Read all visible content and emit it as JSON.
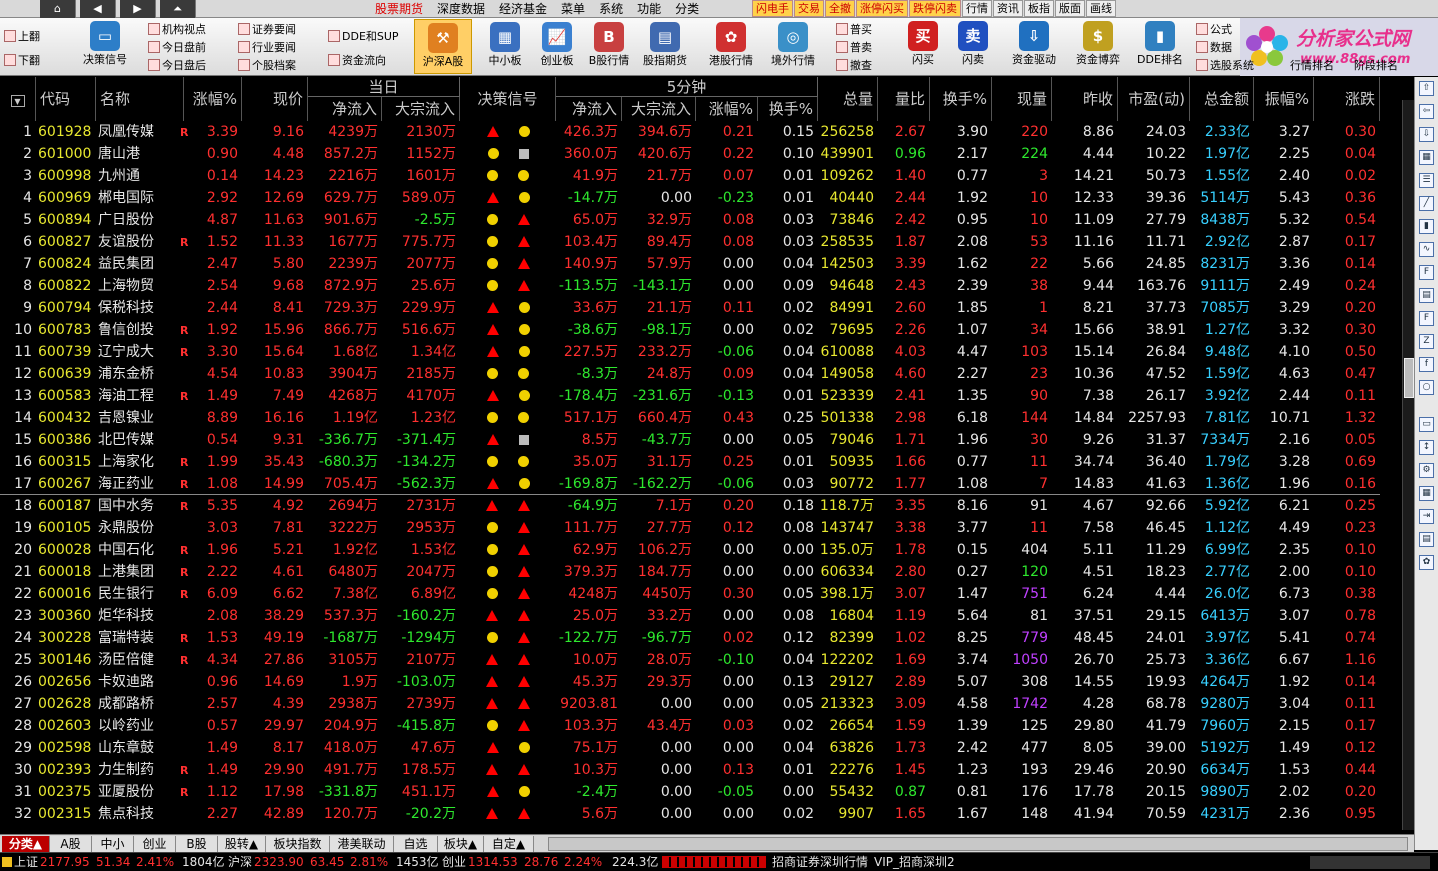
{
  "topbar": {
    "menus": [
      "股票期货",
      "深度数据",
      "经济基金",
      "菜单",
      "系统",
      "功能",
      "分类"
    ],
    "active_menu": "股票期货",
    "quick": [
      "闪电手",
      "交易",
      "全撤",
      "涨停闪买",
      "跌停闪卖",
      "行情",
      "资讯",
      "板指",
      "版面",
      "画线"
    ]
  },
  "toolbar": {
    "page_up": "上翻",
    "page_down": "下翻",
    "decision": "决策信号",
    "group1": [
      "机构视点",
      "今日盘前",
      "今日盘后"
    ],
    "group2": [
      "证券要闻",
      "行业要闻",
      "个股档案"
    ],
    "group3": [
      "DDE和SUP",
      "资金流向"
    ],
    "boards": [
      "沪深A股",
      "中小板",
      "创业板",
      "B股行情",
      "股指期货",
      "港股行情",
      "境外行情"
    ],
    "trade": [
      "普买",
      "普卖",
      "撤查"
    ],
    "flash": [
      "闪买",
      "闪卖"
    ],
    "tools": [
      "资金驱动",
      "资金博弈",
      "DDE排名"
    ],
    "right_small": [
      "公式",
      "数据",
      "选股系统"
    ],
    "rank": [
      "行情排名",
      "阶段排名"
    ]
  },
  "logo": {
    "title": "分析家公式网",
    "url": "www.88gs.com"
  },
  "header": {
    "group_today": "当日",
    "group_5min": "5分钟",
    "columns": [
      "代码",
      "名称",
      "涨幅%",
      "现价",
      "净流入",
      "大宗流入",
      "决策信号",
      "净流入",
      "大宗流入",
      "涨幅%",
      "换手%",
      "总量",
      "量比",
      "换手%",
      "现量",
      "昨收",
      "市盈(动)",
      "总金额",
      "振幅%",
      "涨跌"
    ]
  },
  "rows": [
    [
      "601928",
      "凤凰传媒",
      "R",
      "3.39",
      "9.16",
      "4239万",
      "2130万",
      "tri",
      "dot",
      "426.3万",
      "394.6万",
      "0.21",
      "0.15",
      "256258",
      "2.67",
      "3.90",
      "220",
      "8.86",
      "24.03",
      "2.33亿",
      "3.27",
      "0.30"
    ],
    [
      "601000",
      "唐山港",
      "",
      "0.90",
      "4.48",
      "857.2万",
      "1152万",
      "dot",
      "sq",
      "360.0万",
      "420.6万",
      "0.22",
      "0.10",
      "439901",
      "0.96",
      "2.17",
      "224",
      "4.44",
      "10.22",
      "1.97亿",
      "2.25",
      "0.04"
    ],
    [
      "600998",
      "九州通",
      "",
      "0.14",
      "14.23",
      "2216万",
      "1601万",
      "dot",
      "dot",
      "41.9万",
      "21.7万",
      "0.07",
      "0.01",
      "109262",
      "1.40",
      "0.77",
      "3",
      "14.21",
      "50.73",
      "1.55亿",
      "2.40",
      "0.02"
    ],
    [
      "600969",
      "郴电国际",
      "",
      "2.92",
      "12.69",
      "629.7万",
      "589.0万",
      "tri",
      "dot",
      "-14.7万",
      "0.00",
      "-0.23",
      "0.01",
      "40440",
      "2.44",
      "1.92",
      "10",
      "12.33",
      "39.36",
      "5114万",
      "5.43",
      "0.36"
    ],
    [
      "600894",
      "广日股份",
      "",
      "4.87",
      "11.63",
      "901.6万",
      "-2.5万",
      "dot",
      "tri",
      "65.0万",
      "32.9万",
      "0.08",
      "0.03",
      "73846",
      "2.42",
      "0.95",
      "10",
      "11.09",
      "27.79",
      "8438万",
      "5.32",
      "0.54"
    ],
    [
      "600827",
      "友谊股份",
      "R",
      "1.52",
      "11.33",
      "1677万",
      "775.7万",
      "dot",
      "tri",
      "103.4万",
      "89.4万",
      "0.08",
      "0.03",
      "258535",
      "1.87",
      "2.08",
      "53",
      "11.16",
      "11.71",
      "2.92亿",
      "2.87",
      "0.17"
    ],
    [
      "600824",
      "益民集团",
      "",
      "2.47",
      "5.80",
      "2239万",
      "2077万",
      "dot",
      "tri",
      "140.9万",
      "57.9万",
      "0.00",
      "0.04",
      "142503",
      "3.39",
      "1.62",
      "22",
      "5.66",
      "24.85",
      "8231万",
      "3.36",
      "0.14"
    ],
    [
      "600822",
      "上海物贸",
      "",
      "2.54",
      "9.68",
      "872.9万",
      "25.6万",
      "dot",
      "tri",
      "-113.5万",
      "-143.1万",
      "0.00",
      "0.09",
      "94648",
      "2.43",
      "2.39",
      "38",
      "9.44",
      "163.76",
      "9111万",
      "2.49",
      "0.24"
    ],
    [
      "600794",
      "保税科技",
      "",
      "2.44",
      "8.41",
      "729.3万",
      "229.9万",
      "tri",
      "dot",
      "33.6万",
      "21.1万",
      "0.11",
      "0.02",
      "84991",
      "2.60",
      "1.85",
      "1",
      "8.21",
      "37.73",
      "7085万",
      "3.29",
      "0.20"
    ],
    [
      "600783",
      "鲁信创投",
      "R",
      "1.92",
      "15.96",
      "866.7万",
      "516.6万",
      "tri",
      "dot",
      "-38.6万",
      "-98.1万",
      "0.00",
      "0.02",
      "79695",
      "2.26",
      "1.07",
      "34",
      "15.66",
      "38.91",
      "1.27亿",
      "3.32",
      "0.30"
    ],
    [
      "600739",
      "辽宁成大",
      "R",
      "3.30",
      "15.64",
      "1.68亿",
      "1.34亿",
      "tri",
      "dot",
      "227.5万",
      "233.2万",
      "-0.06",
      "0.04",
      "610088",
      "4.03",
      "4.47",
      "103",
      "15.14",
      "26.84",
      "9.48亿",
      "4.10",
      "0.50"
    ],
    [
      "600639",
      "浦东金桥",
      "",
      "4.54",
      "10.83",
      "3904万",
      "2185万",
      "dot",
      "dot",
      "-8.3万",
      "24.8万",
      "0.09",
      "0.04",
      "149058",
      "4.60",
      "2.27",
      "23",
      "10.36",
      "47.52",
      "1.59亿",
      "4.63",
      "0.47"
    ],
    [
      "600583",
      "海油工程",
      "R",
      "1.49",
      "7.49",
      "4268万",
      "4170万",
      "tri",
      "dot",
      "-178.4万",
      "-231.6万",
      "-0.13",
      "0.01",
      "523339",
      "2.41",
      "1.35",
      "90",
      "7.38",
      "26.17",
      "3.92亿",
      "2.44",
      "0.11"
    ],
    [
      "600432",
      "吉恩镍业",
      "",
      "8.89",
      "16.16",
      "1.19亿",
      "1.23亿",
      "dot",
      "dot",
      "517.1万",
      "660.4万",
      "0.43",
      "0.25",
      "501338",
      "2.98",
      "6.18",
      "144",
      "14.84",
      "2257.93",
      "7.81亿",
      "10.71",
      "1.32"
    ],
    [
      "600386",
      "北巴传媒",
      "",
      "0.54",
      "9.31",
      "-336.7万",
      "-371.4万",
      "tri",
      "sq",
      "8.5万",
      "-43.7万",
      "0.00",
      "0.05",
      "79046",
      "1.71",
      "1.96",
      "30",
      "9.26",
      "31.37",
      "7334万",
      "2.16",
      "0.05"
    ],
    [
      "600315",
      "上海家化",
      "R",
      "1.99",
      "35.43",
      "-680.3万",
      "-134.2万",
      "dot",
      "dot",
      "35.0万",
      "31.1万",
      "0.25",
      "0.01",
      "50935",
      "1.66",
      "0.77",
      "11",
      "34.74",
      "36.40",
      "1.79亿",
      "3.28",
      "0.69"
    ],
    [
      "600267",
      "海正药业",
      "R",
      "1.08",
      "14.99",
      "705.4万",
      "-562.3万",
      "tri",
      "dot",
      "-169.8万",
      "-162.2万",
      "-0.06",
      "0.03",
      "90772",
      "1.77",
      "1.08",
      "7",
      "14.83",
      "41.63",
      "1.36亿",
      "1.96",
      "0.16"
    ],
    [
      "600187",
      "国中水务",
      "R",
      "5.35",
      "4.92",
      "2694万",
      "2731万",
      "tri",
      "tri",
      "-64.9万",
      "7.1万",
      "0.20",
      "0.18",
      "118.7万",
      "3.35",
      "8.16",
      "91",
      "4.67",
      "92.66",
      "5.92亿",
      "6.21",
      "0.25"
    ],
    [
      "600105",
      "永鼎股份",
      "",
      "3.03",
      "7.81",
      "3222万",
      "2953万",
      "dot",
      "tri",
      "111.7万",
      "27.7万",
      "0.12",
      "0.08",
      "143747",
      "3.38",
      "3.77",
      "11",
      "7.58",
      "46.45",
      "1.12亿",
      "4.49",
      "0.23"
    ],
    [
      "600028",
      "中国石化",
      "R",
      "1.96",
      "5.21",
      "1.92亿",
      "1.53亿",
      "dot",
      "tri",
      "62.9万",
      "106.2万",
      "0.00",
      "0.00",
      "135.0万",
      "1.78",
      "0.15",
      "404",
      "5.11",
      "11.29",
      "6.99亿",
      "2.35",
      "0.10"
    ],
    [
      "600018",
      "上港集团",
      "R",
      "2.22",
      "4.61",
      "6480万",
      "2047万",
      "dot",
      "tri",
      "379.3万",
      "184.7万",
      "0.00",
      "0.00",
      "606334",
      "2.80",
      "0.27",
      "120",
      "4.51",
      "18.23",
      "2.77亿",
      "2.00",
      "0.10"
    ],
    [
      "600016",
      "民生银行",
      "R",
      "6.09",
      "6.62",
      "7.38亿",
      "6.89亿",
      "dot",
      "tri",
      "4248万",
      "4450万",
      "0.30",
      "0.05",
      "398.1万",
      "3.07",
      "1.47",
      "751",
      "6.24",
      "4.44",
      "26.0亿",
      "6.73",
      "0.38"
    ],
    [
      "300360",
      "炬华科技",
      "",
      "2.08",
      "38.29",
      "537.3万",
      "-160.2万",
      "tri",
      "tri",
      "25.0万",
      "33.2万",
      "0.00",
      "0.08",
      "16804",
      "1.19",
      "5.64",
      "81",
      "37.51",
      "29.15",
      "6413万",
      "3.07",
      "0.78"
    ],
    [
      "300228",
      "富瑞特装",
      "R",
      "1.53",
      "49.19",
      "-1687万",
      "-1294万",
      "dot",
      "tri",
      "-122.7万",
      "-96.7万",
      "0.02",
      "0.12",
      "82399",
      "1.02",
      "8.25",
      "779",
      "48.45",
      "24.01",
      "3.97亿",
      "5.41",
      "0.74"
    ],
    [
      "300146",
      "汤臣倍健",
      "R",
      "4.34",
      "27.86",
      "3105万",
      "2107万",
      "tri",
      "tri",
      "10.0万",
      "28.0万",
      "-0.10",
      "0.04",
      "122202",
      "1.69",
      "3.74",
      "1050",
      "26.70",
      "25.73",
      "3.36亿",
      "6.67",
      "1.16"
    ],
    [
      "002656",
      "卡奴迪路",
      "",
      "0.96",
      "14.69",
      "1.9万",
      "-103.0万",
      "tri",
      "tri",
      "45.3万",
      "29.3万",
      "0.00",
      "0.13",
      "29127",
      "2.89",
      "5.07",
      "308",
      "14.55",
      "19.93",
      "4264万",
      "1.92",
      "0.14"
    ],
    [
      "002628",
      "成都路桥",
      "",
      "2.57",
      "4.39",
      "2938万",
      "2739万",
      "tri",
      "tri",
      "9203.81",
      "0.00",
      "0.00",
      "0.05",
      "213323",
      "3.09",
      "4.58",
      "1742",
      "4.28",
      "68.78",
      "9280万",
      "3.04",
      "0.11"
    ],
    [
      "002603",
      "以岭药业",
      "",
      "0.57",
      "29.97",
      "204.9万",
      "-415.8万",
      "dot",
      "tri",
      "103.3万",
      "43.4万",
      "0.03",
      "0.02",
      "26654",
      "1.59",
      "1.39",
      "125",
      "29.80",
      "41.79",
      "7960万",
      "2.15",
      "0.17"
    ],
    [
      "002598",
      "山东章鼓",
      "",
      "1.49",
      "8.17",
      "418.0万",
      "47.6万",
      "tri",
      "dot",
      "75.1万",
      "0.00",
      "0.00",
      "0.04",
      "63826",
      "1.73",
      "2.42",
      "477",
      "8.05",
      "39.00",
      "5192万",
      "1.49",
      "0.12"
    ],
    [
      "002393",
      "力生制药",
      "R",
      "1.49",
      "29.90",
      "491.7万",
      "178.5万",
      "tri",
      "tri",
      "10.3万",
      "0.00",
      "0.13",
      "0.01",
      "22276",
      "1.45",
      "1.23",
      "193",
      "29.46",
      "20.90",
      "6634万",
      "1.53",
      "0.44"
    ],
    [
      "002375",
      "亚厦股份",
      "R",
      "1.12",
      "17.98",
      "-331.8万",
      "451.1万",
      "tri",
      "dot",
      "-2.4万",
      "0.00",
      "-0.05",
      "0.00",
      "55432",
      "0.87",
      "0.81",
      "176",
      "17.78",
      "20.15",
      "9890万",
      "2.02",
      "0.20"
    ],
    [
      "002315",
      "焦点科技",
      "",
      "2.27",
      "42.89",
      "120.7万",
      "-20.2万",
      "tri",
      "tri",
      "5.6万",
      "0.00",
      "0.00",
      "0.02",
      "9907",
      "1.65",
      "1.67",
      "148",
      "41.94",
      "70.59",
      "4231万",
      "2.36",
      "0.95"
    ]
  ],
  "tabs": [
    "分类▲",
    "A股",
    "中小",
    "创业",
    "B股",
    "股转▲",
    "板块指数",
    "港美联动",
    "自选",
    "板块▲",
    "自定▲"
  ],
  "status": {
    "sh_label": "上证",
    "sh_val": "2177.95",
    "sh_chg": "51.34",
    "sh_pct": "2.41%",
    "sh_amt": "1804亿",
    "hs_label": "沪深",
    "hs_val": "2323.90",
    "hs_chg": "63.45",
    "hs_pct": "2.81%",
    "hs_amt": "1453亿",
    "cy_label": "创业",
    "cy_val": "1314.53",
    "cy_chg": "28.76",
    "cy_pct": "2.24%",
    "cy_amt": "224.3亿",
    "broker": "招商证券深圳行情",
    "vip": "VIP_招商深圳2"
  }
}
